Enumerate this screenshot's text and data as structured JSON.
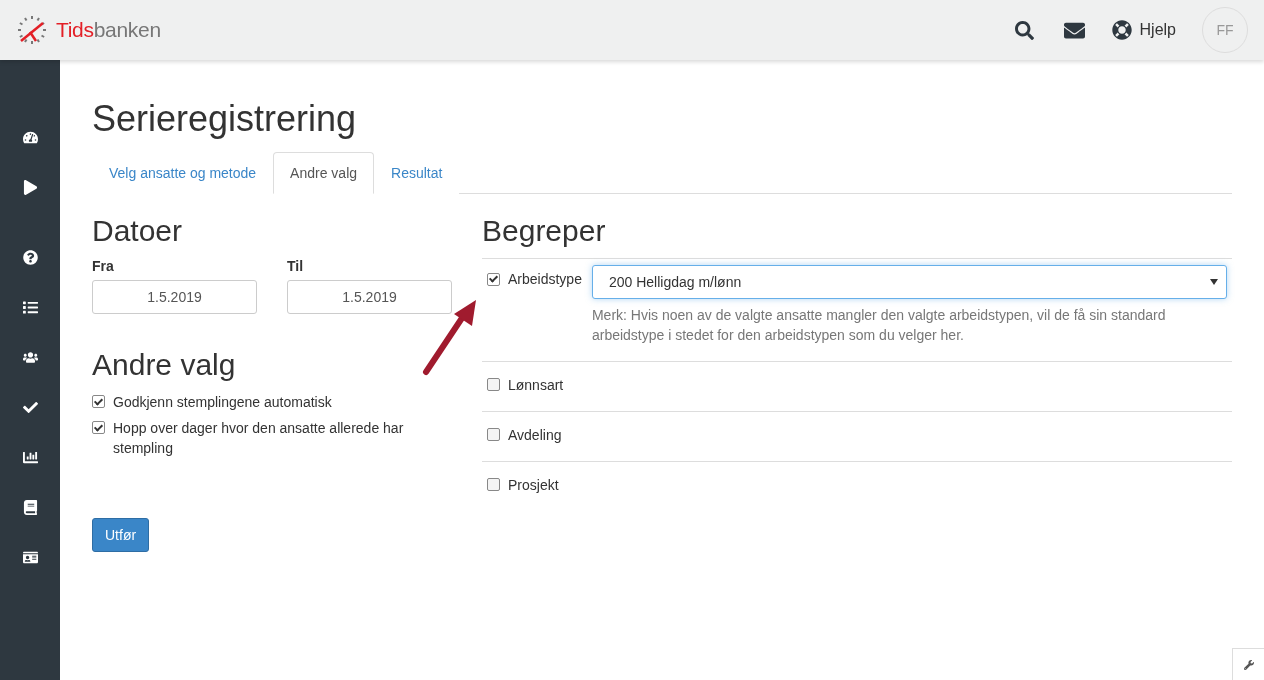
{
  "header": {
    "logo": {
      "accent": "Tids",
      "text": "banken"
    },
    "help_label": "Hjelp",
    "avatar": "FF"
  },
  "page": {
    "title": "Serieregistrering"
  },
  "tabs": [
    {
      "label": "Velg ansatte og metode",
      "selected": false
    },
    {
      "label": "Andre valg",
      "selected": true
    },
    {
      "label": "Resultat",
      "selected": false
    }
  ],
  "dates": {
    "heading": "Datoer",
    "fields": [
      {
        "label": "Fra",
        "value": "1.5.2019"
      },
      {
        "label": "Til",
        "value": "1.5.2019"
      }
    ]
  },
  "other_options": {
    "heading": "Andre valg",
    "items": [
      {
        "label": "Godkjenn stemplingene automatisk",
        "checked": true
      },
      {
        "label": "Hopp over dager hvor den ansatte allerede har stempling",
        "checked": true
      }
    ]
  },
  "submit_button": "Utfør",
  "concepts": {
    "heading": "Begreper",
    "items": [
      {
        "label": "Arbeidstype",
        "checked": true,
        "select_value": "200 Helligdag m/lønn",
        "note": "Merk: Hvis noen av de valgte ansatte mangler den valgte arbeidstypen, vil de få sin standard arbeidstype i stedet for den arbeidstypen som du velger her."
      },
      {
        "label": "Lønnsart",
        "checked": false
      },
      {
        "label": "Avdeling",
        "checked": false
      },
      {
        "label": "Prosjekt",
        "checked": false
      }
    ]
  }
}
